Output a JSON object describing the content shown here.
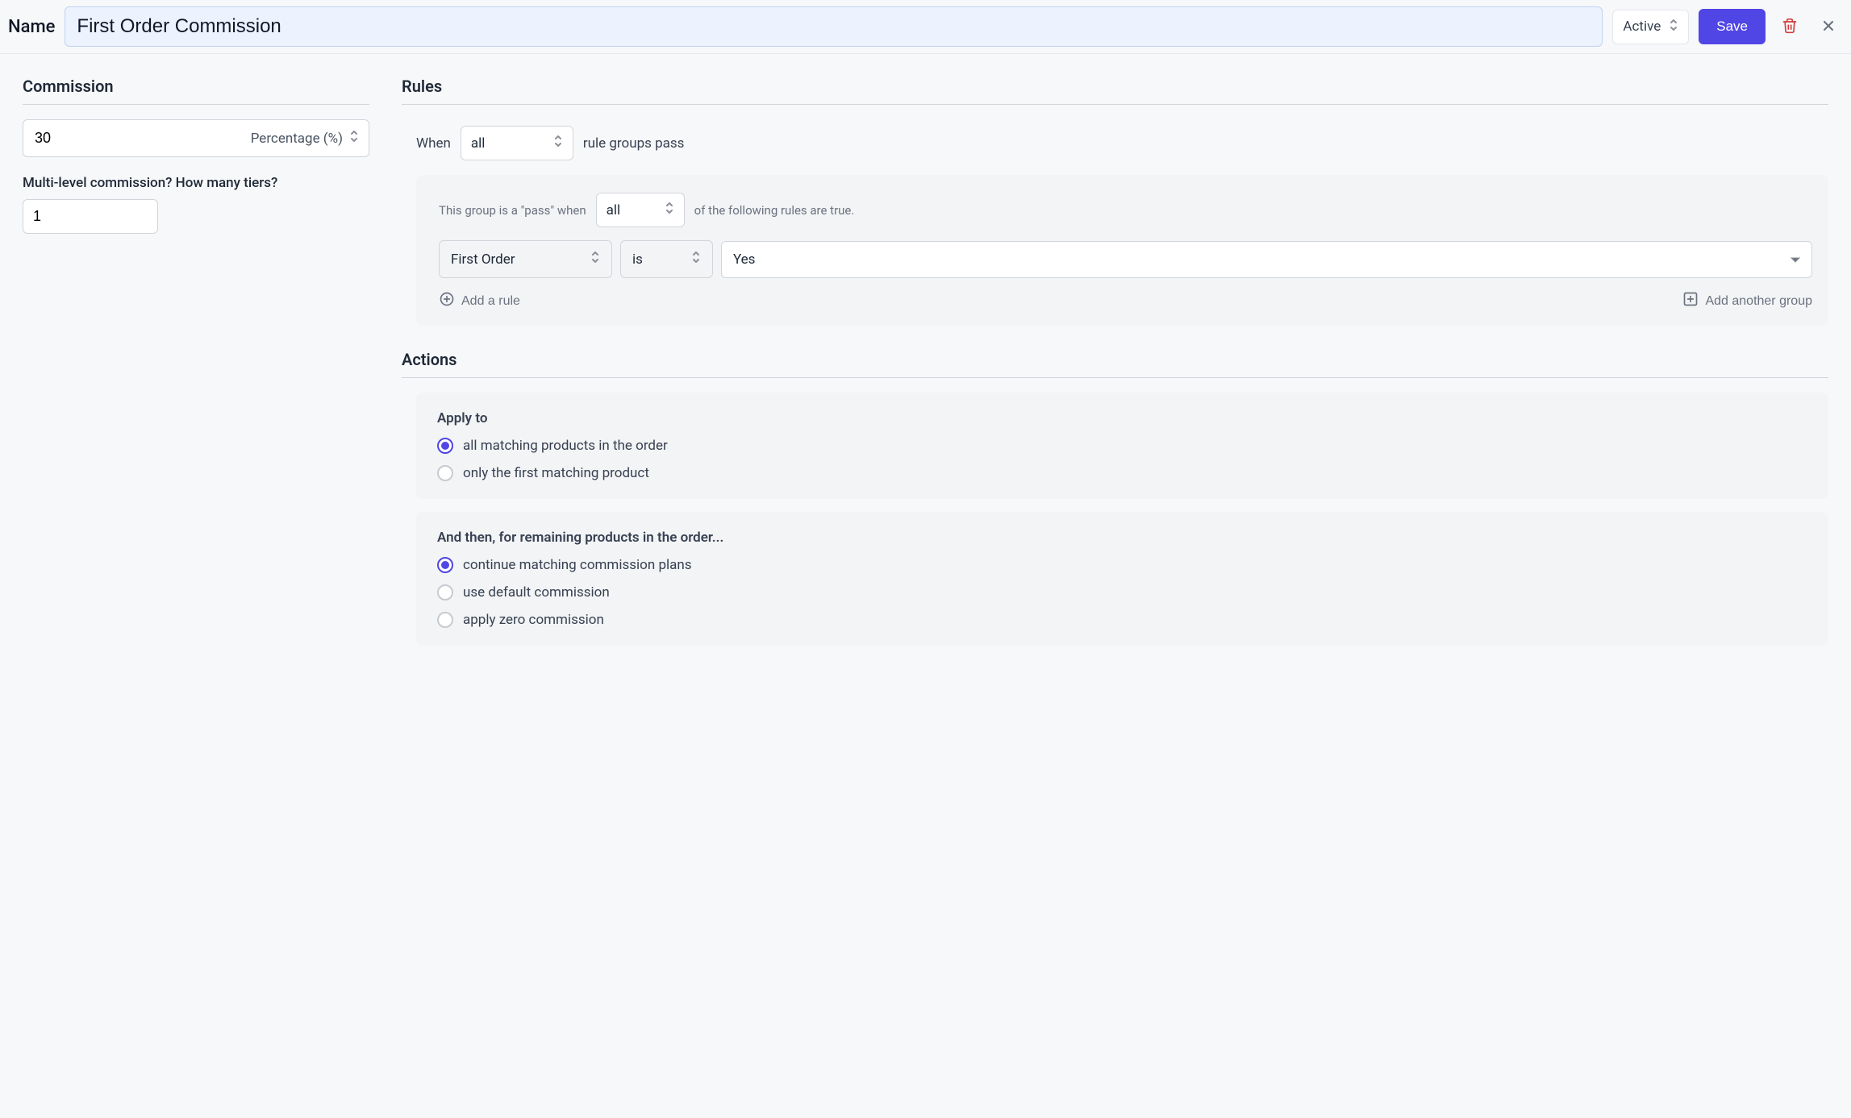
{
  "header": {
    "name_label": "Name",
    "name_value": "First Order Commission",
    "status_value": "Active",
    "save_label": "Save"
  },
  "commission": {
    "heading": "Commission",
    "value": "30",
    "unit_label": "Percentage (%)",
    "tiers_label": "Multi-level commission? How many tiers?",
    "tiers_value": "1"
  },
  "rules": {
    "heading": "Rules",
    "when_label": "When",
    "when_mode": "all",
    "when_suffix": "rule groups pass",
    "group": {
      "prefix": "This group is a \"pass\" when",
      "mode": "all",
      "suffix": "of the following rules are true.",
      "rule": {
        "subject": "First Order",
        "operator": "is",
        "value": "Yes"
      },
      "add_rule_label": "Add a rule",
      "add_group_label": "Add another group"
    }
  },
  "actions": {
    "heading": "Actions",
    "apply_to_heading": "Apply to",
    "apply_to_options": {
      "all": "all matching products in the order",
      "first": "only the first matching product"
    },
    "apply_to_selected": "all",
    "then_heading": "And then, for remaining products in the order...",
    "then_options": {
      "continue": "continue matching commission plans",
      "default": "use default commission",
      "zero": "apply zero commission"
    },
    "then_selected": "continue"
  }
}
